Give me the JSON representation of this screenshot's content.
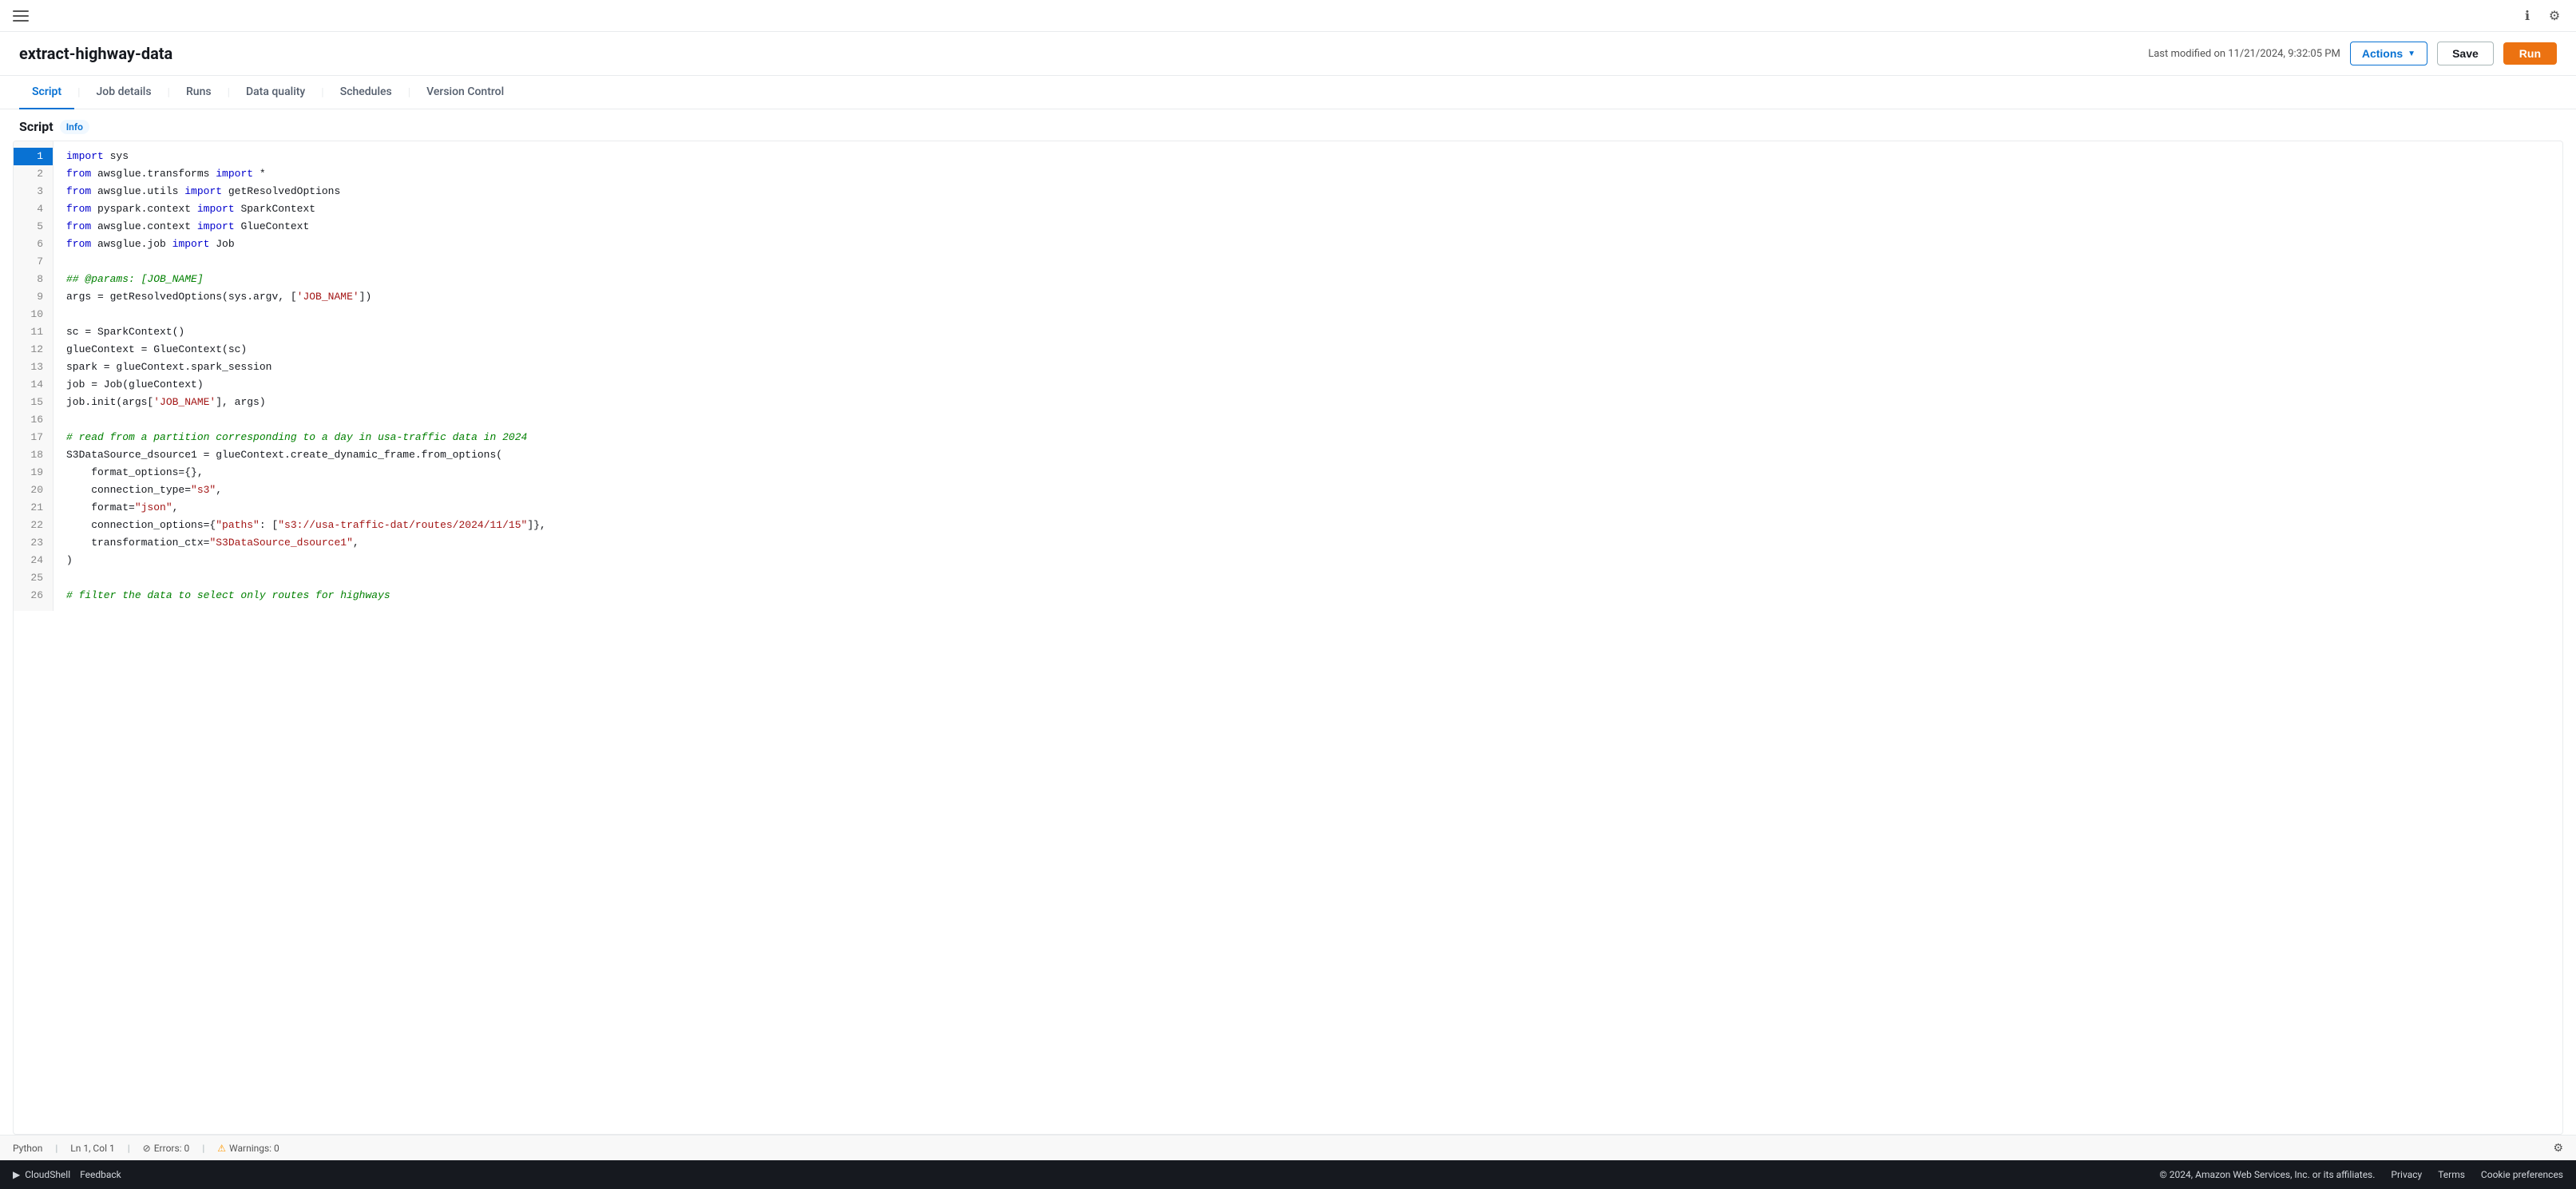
{
  "topNav": {
    "hamburger": "☰"
  },
  "header": {
    "title": "extract-highway-data",
    "lastModified": "Last modified on 11/21/2024, 9:32:05 PM",
    "actionsLabel": "Actions",
    "saveLabel": "Save",
    "runLabel": "Run"
  },
  "tabs": [
    {
      "id": "script",
      "label": "Script",
      "active": true
    },
    {
      "id": "job-details",
      "label": "Job details",
      "active": false
    },
    {
      "id": "runs",
      "label": "Runs",
      "active": false
    },
    {
      "id": "data-quality",
      "label": "Data quality",
      "active": false
    },
    {
      "id": "schedules",
      "label": "Schedules",
      "active": false
    },
    {
      "id": "version-control",
      "label": "Version Control",
      "active": false
    }
  ],
  "script": {
    "title": "Script",
    "infoBadge": "Info"
  },
  "statusBar": {
    "language": "Python",
    "position": "Ln 1, Col 1",
    "errors": "Errors: 0",
    "warnings": "Warnings: 0"
  },
  "footer": {
    "cloudshell": "CloudShell",
    "feedback": "Feedback",
    "copyright": "© 2024, Amazon Web Services, Inc. or its affiliates.",
    "privacy": "Privacy",
    "terms": "Terms",
    "cookiePrefs": "Cookie preferences"
  },
  "codeLines": [
    {
      "num": 1,
      "active": true,
      "tokens": [
        {
          "t": "kw",
          "v": "import"
        },
        {
          "t": "plain",
          "v": " sys"
        }
      ]
    },
    {
      "num": 2,
      "active": false,
      "tokens": [
        {
          "t": "kw",
          "v": "from"
        },
        {
          "t": "plain",
          "v": " awsglue.transforms "
        },
        {
          "t": "kw",
          "v": "import"
        },
        {
          "t": "plain",
          "v": " *"
        }
      ]
    },
    {
      "num": 3,
      "active": false,
      "tokens": [
        {
          "t": "kw",
          "v": "from"
        },
        {
          "t": "plain",
          "v": " awsglue.utils "
        },
        {
          "t": "kw",
          "v": "import"
        },
        {
          "t": "plain",
          "v": " getResolvedOptions"
        }
      ]
    },
    {
      "num": 4,
      "active": false,
      "tokens": [
        {
          "t": "kw",
          "v": "from"
        },
        {
          "t": "plain",
          "v": " pyspark.context "
        },
        {
          "t": "kw",
          "v": "import"
        },
        {
          "t": "plain",
          "v": " SparkContext"
        }
      ]
    },
    {
      "num": 5,
      "active": false,
      "tokens": [
        {
          "t": "kw",
          "v": "from"
        },
        {
          "t": "plain",
          "v": " awsglue.context "
        },
        {
          "t": "kw",
          "v": "import"
        },
        {
          "t": "plain",
          "v": " GlueContext"
        }
      ]
    },
    {
      "num": 6,
      "active": false,
      "tokens": [
        {
          "t": "kw",
          "v": "from"
        },
        {
          "t": "plain",
          "v": " awsglue.job "
        },
        {
          "t": "kw",
          "v": "import"
        },
        {
          "t": "plain",
          "v": " Job"
        }
      ]
    },
    {
      "num": 7,
      "active": false,
      "tokens": []
    },
    {
      "num": 8,
      "active": false,
      "tokens": [
        {
          "t": "cm",
          "v": "## @params: [JOB_NAME]"
        }
      ]
    },
    {
      "num": 9,
      "active": false,
      "tokens": [
        {
          "t": "plain",
          "v": "args = getResolvedOptions(sys.argv, ["
        },
        {
          "t": "str",
          "v": "'JOB_NAME'"
        },
        {
          "t": "plain",
          "v": "])"
        }
      ]
    },
    {
      "num": 10,
      "active": false,
      "tokens": []
    },
    {
      "num": 11,
      "active": false,
      "tokens": [
        {
          "t": "plain",
          "v": "sc = SparkContext()"
        }
      ]
    },
    {
      "num": 12,
      "active": false,
      "tokens": [
        {
          "t": "plain",
          "v": "glueContext = GlueContext(sc)"
        }
      ]
    },
    {
      "num": 13,
      "active": false,
      "tokens": [
        {
          "t": "plain",
          "v": "spark = glueContext.spark_session"
        }
      ]
    },
    {
      "num": 14,
      "active": false,
      "tokens": [
        {
          "t": "plain",
          "v": "job = Job(glueContext)"
        }
      ]
    },
    {
      "num": 15,
      "active": false,
      "tokens": [
        {
          "t": "plain",
          "v": "job.init(args["
        },
        {
          "t": "str",
          "v": "'JOB_NAME'"
        },
        {
          "t": "plain",
          "v": "], args)"
        }
      ]
    },
    {
      "num": 16,
      "active": false,
      "tokens": []
    },
    {
      "num": 17,
      "active": false,
      "tokens": [
        {
          "t": "cm",
          "v": "# read from a partition corresponding to a day in usa-traffic data in 2024"
        }
      ]
    },
    {
      "num": 18,
      "active": false,
      "tokens": [
        {
          "t": "plain",
          "v": "S3DataSource_dsource1 = glueContext.create_dynamic_frame.from_options("
        }
      ]
    },
    {
      "num": 19,
      "active": false,
      "tokens": [
        {
          "t": "plain",
          "v": "    format_options={},"
        }
      ]
    },
    {
      "num": 20,
      "active": false,
      "tokens": [
        {
          "t": "plain",
          "v": "    connection_type="
        },
        {
          "t": "str",
          "v": "\"s3\""
        },
        {
          "t": "plain",
          "v": ","
        }
      ]
    },
    {
      "num": 21,
      "active": false,
      "tokens": [
        {
          "t": "plain",
          "v": "    format="
        },
        {
          "t": "str",
          "v": "\"json\""
        },
        {
          "t": "plain",
          "v": ","
        }
      ]
    },
    {
      "num": 22,
      "active": false,
      "tokens": [
        {
          "t": "plain",
          "v": "    connection_options={"
        },
        {
          "t": "str",
          "v": "\"paths\""
        },
        {
          "t": "plain",
          "v": ": ["
        },
        {
          "t": "str",
          "v": "\"s3://usa-traffic-dat/routes/2024/11/15\""
        },
        {
          "t": "plain",
          "v": "]},"
        }
      ]
    },
    {
      "num": 23,
      "active": false,
      "tokens": [
        {
          "t": "plain",
          "v": "    transformation_ctx="
        },
        {
          "t": "str",
          "v": "\"S3DataSource_dsource1\""
        },
        {
          "t": "plain",
          "v": ","
        }
      ]
    },
    {
      "num": 24,
      "active": false,
      "tokens": [
        {
          "t": "plain",
          "v": ")"
        }
      ]
    },
    {
      "num": 25,
      "active": false,
      "tokens": []
    },
    {
      "num": 26,
      "active": false,
      "tokens": [
        {
          "t": "cm",
          "v": "# filter the data to select only routes for highways"
        }
      ]
    }
  ]
}
